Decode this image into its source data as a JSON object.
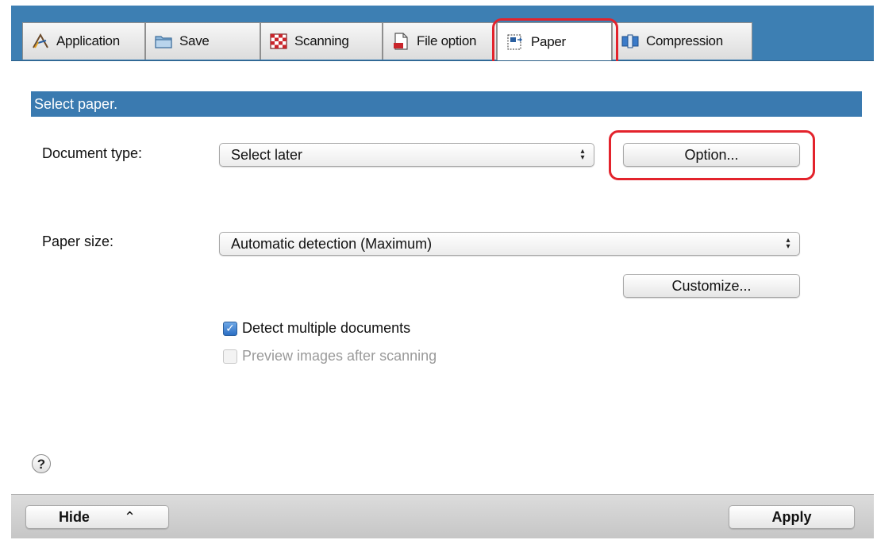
{
  "tabs": [
    {
      "label": "Application",
      "icon": "application-icon"
    },
    {
      "label": "Save",
      "icon": "save-folder-icon"
    },
    {
      "label": "Scanning",
      "icon": "scanning-icon"
    },
    {
      "label": "File option",
      "icon": "file-option-icon"
    },
    {
      "label": "Paper",
      "icon": "paper-icon",
      "active": true
    },
    {
      "label": "Compression",
      "icon": "compression-icon"
    }
  ],
  "section": {
    "header": "Select paper."
  },
  "document_type": {
    "label": "Document type:",
    "value": "Select later",
    "option_button": "Option..."
  },
  "paper_size": {
    "label": "Paper size:",
    "value": "Automatic detection (Maximum)",
    "customize_button": "Customize..."
  },
  "checkboxes": [
    {
      "label": "Detect multiple documents",
      "checked": true,
      "enabled": true
    },
    {
      "label": "Preview images after scanning",
      "checked": false,
      "enabled": false
    }
  ],
  "help": {
    "glyph": "?"
  },
  "footer": {
    "hide_label": "Hide",
    "hide_glyph": "⌃",
    "apply_label": "Apply"
  },
  "colors": {
    "tabbar": "#3d7fb3",
    "header_bar": "#3a7ab0",
    "highlight": "#e3232c",
    "checkbox": "#2c6fc4"
  }
}
